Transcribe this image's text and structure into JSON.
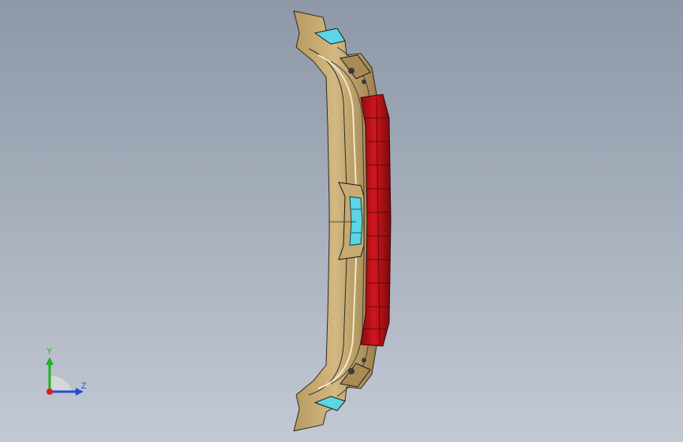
{
  "viewport": {
    "background_top": "#8e98a6",
    "background_bottom": "#c3c9d3"
  },
  "model": {
    "body_color": "#c7aa72",
    "body_shadow_color": "#8a6f3f",
    "light_color": "#c0131a",
    "light_dark_color": "#7a0a0e",
    "glass_color": "#5ad6e6"
  },
  "triad": {
    "y_label": "Y",
    "z_label": "Z",
    "y_color": "#1fb21f",
    "z_color": "#1f4fd6",
    "x_color": "#d61f1f"
  }
}
